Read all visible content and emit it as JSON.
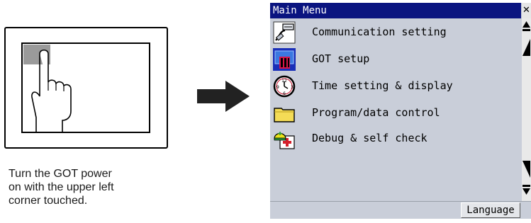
{
  "instruction": {
    "text": "Turn the GOT power\non with the upper left\ncorner touched."
  },
  "window": {
    "title": "Main Menu",
    "menu_items": [
      {
        "label": "Communication setting",
        "icon": "communication-setting-icon"
      },
      {
        "label": "GOT setup",
        "icon": "got-setup-icon"
      },
      {
        "label": "Time setting & display",
        "icon": "clock-icon"
      },
      {
        "label": "Program/data control",
        "icon": "folder-icon"
      },
      {
        "label": "Debug & self check",
        "icon": "debug-icon"
      }
    ],
    "language_button": "Language"
  },
  "colors": {
    "titlebar": "#0a1480",
    "screen_background": "#c9ced9",
    "touch_corner": "#9a9a9a"
  }
}
